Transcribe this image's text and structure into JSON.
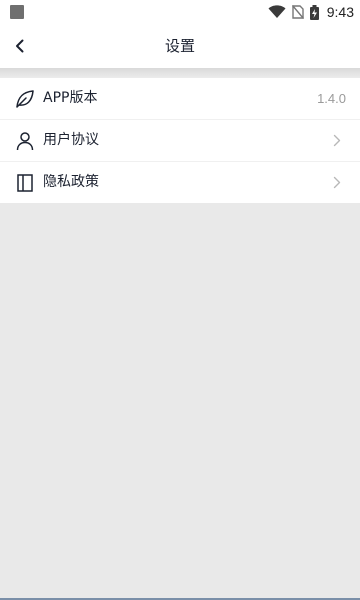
{
  "status_bar": {
    "time": "9:43",
    "icons": [
      "notification-square-icon",
      "wifi-icon",
      "no-sim-icon",
      "battery-charging-icon"
    ]
  },
  "header": {
    "title": "设置",
    "back_icon": "chevron-left-icon"
  },
  "settings": {
    "items": [
      {
        "icon": "leaf-icon",
        "label": "APP版本",
        "value": "1.4.0"
      },
      {
        "icon": "user-icon",
        "label": "用户协议",
        "trailing_icon": "chevron-right-icon"
      },
      {
        "icon": "book-icon",
        "label": "隐私政策",
        "trailing_icon": "chevron-right-icon"
      }
    ]
  },
  "colors": {
    "background": "#e9e9e9",
    "surface": "#ffffff",
    "text_primary": "#1c2230",
    "text_secondary": "#9a9a9a"
  }
}
